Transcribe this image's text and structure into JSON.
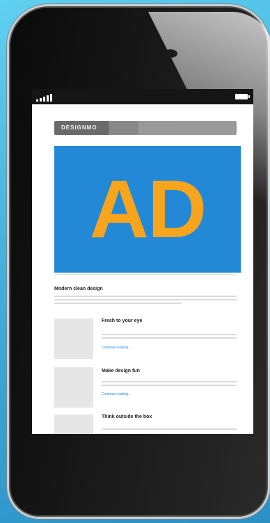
{
  "status_bar": {
    "signal_icon": "signal-bars-icon",
    "battery_icon": "battery-icon"
  },
  "site": {
    "logo": "DESIGNMO"
  },
  "ad": {
    "text": "AD",
    "background": "#2389d6",
    "text_color": "#f7a51c"
  },
  "featured": {
    "title": "Modern clean design"
  },
  "articles": [
    {
      "title": "Fresh to your eye",
      "link": "Continue reading..."
    },
    {
      "title": "Make design fun",
      "link": "Continue reading..."
    },
    {
      "title": "Think outside the box"
    }
  ]
}
